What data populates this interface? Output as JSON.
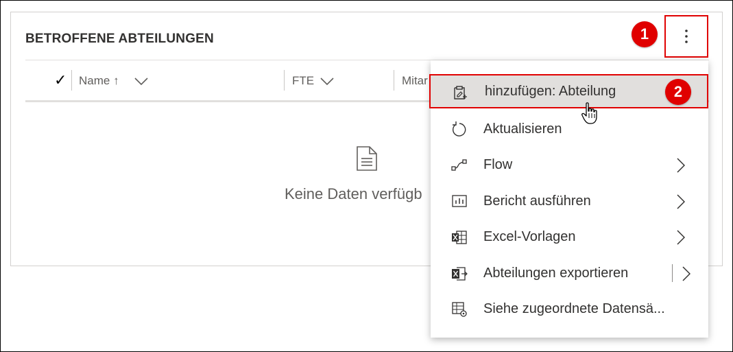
{
  "panel": {
    "title": "BETROFFENE ABTEILUNGEN",
    "columns": [
      {
        "label": "Name ↑"
      },
      {
        "label": "FTE"
      },
      {
        "label": "Mitar"
      }
    ],
    "empty_text": "Keine Daten verfügb"
  },
  "badges": {
    "step1": "1",
    "step2": "2"
  },
  "menu": {
    "items": [
      {
        "label": "hinzufügen: Abteilung",
        "icon": "clipboard-add-icon"
      },
      {
        "label": "Aktualisieren",
        "icon": "refresh-icon"
      },
      {
        "label": "Flow",
        "icon": "flow-icon"
      },
      {
        "label": "Bericht ausführen",
        "icon": "report-icon"
      },
      {
        "label": "Excel-Vorlagen",
        "icon": "excel-template-icon"
      },
      {
        "label": "Abteilungen exportieren",
        "icon": "excel-export-icon"
      },
      {
        "label": "Siehe zugeordnete Datensä...",
        "icon": "related-records-icon"
      }
    ]
  },
  "colors": {
    "highlight": "#e00000",
    "hover_bg": "#e1dfdd"
  }
}
